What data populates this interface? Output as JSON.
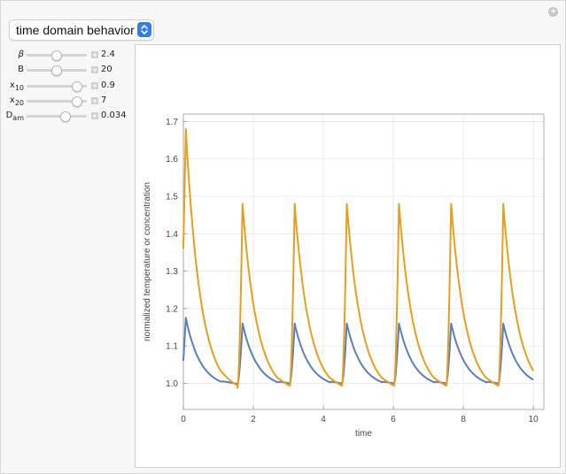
{
  "dropdown": {
    "selected": "time domain behavior"
  },
  "controls": [
    {
      "label": "β",
      "italic": true,
      "value": "2.4",
      "fraction": 0.48
    },
    {
      "label": "B",
      "italic": false,
      "value": "20",
      "fraction": 0.48
    },
    {
      "label": "x10",
      "italic": false,
      "value": "0.9",
      "fraction": 0.82
    },
    {
      "label": "x20",
      "italic": false,
      "value": "7",
      "fraction": 0.82
    },
    {
      "label": "Dam",
      "italic": false,
      "value": "0.034",
      "fraction": 0.63
    }
  ],
  "chart_data": {
    "type": "line",
    "xlabel": "time",
    "ylabel": "normalized temperature or concentration",
    "xlim": [
      0,
      10.3
    ],
    "ylim": [
      0.93,
      1.72
    ],
    "x_ticks": [
      "0",
      "2",
      "4",
      "6",
      "8",
      "10"
    ],
    "y_ticks": [
      "1.0",
      "1.1",
      "1.2",
      "1.3",
      "1.4",
      "1.5",
      "1.6",
      "1.7"
    ],
    "grid": true,
    "colors": {
      "series1": "#5b7fb7",
      "series2": "#e59f1e"
    },
    "period": 1.49,
    "first_peak": 1.69,
    "series": [
      {
        "key": "series1",
        "peak": 1.16,
        "trough": 0.993,
        "initial": 1.06,
        "initial_peak": 1.175,
        "end": 1.03
      },
      {
        "key": "series2",
        "peak": 1.48,
        "trough": 0.973,
        "initial": 1.36,
        "initial_peak": 1.68,
        "end": 1.0
      }
    ]
  }
}
